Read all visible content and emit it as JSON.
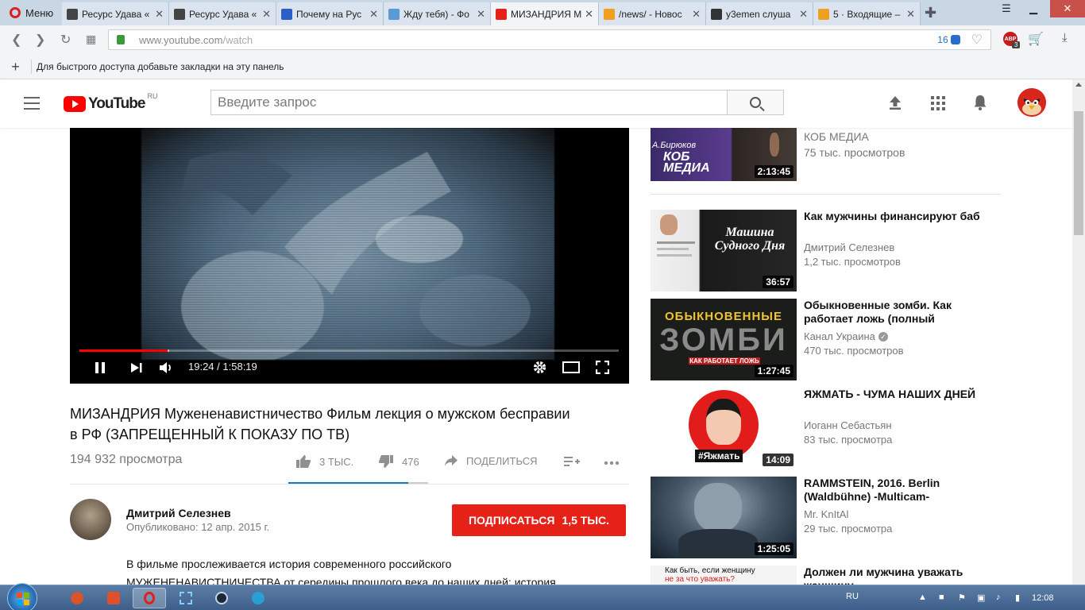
{
  "browser": {
    "menu_label": "Меню",
    "tabs": [
      {
        "title": "Ресурс Удава «",
        "fav_color": "#444444"
      },
      {
        "title": "Ресурс Удава «",
        "fav_color": "#444444"
      },
      {
        "title": "Почему на Рус",
        "fav_color": "#2a5fc7"
      },
      {
        "title": "Жду тебя) - Фо",
        "fav_color": "#5b9bd5"
      },
      {
        "title": "МИЗАНДРИЯ М",
        "fav_color": "#e62117"
      },
      {
        "title": "/news/ - Новос",
        "fav_color": "#f0a020"
      },
      {
        "title": "y3emen слуша",
        "fav_color": "#333333"
      },
      {
        "title": "5 · Входящие –",
        "fav_color": "#f0a020"
      }
    ],
    "url_host": "www.youtube.com",
    "url_path": "/watch",
    "tracker_count": "16",
    "abp_label": "ABP",
    "abp_count": "3",
    "bookmarks_hint": "Для быстрого доступа добавьте закладки на эту панель"
  },
  "youtube": {
    "logo_text": "YouTube",
    "region": "RU",
    "search_placeholder": "Введите запрос"
  },
  "player": {
    "time_current": "19:24",
    "time_total": "1:58:19",
    "progress_played": 0.164,
    "progress_buffered": 0.167
  },
  "video": {
    "title": "МИЗАНДРИЯ Мужененавистничество Фильм лекция о мужском бесправии в РФ (ЗАПРЕЩЕННЫЙ К ПОКАЗУ ПО ТВ)",
    "views": "194 932 просмотра",
    "likes": "3 ТЫС.",
    "dislikes": "476",
    "share_label": "ПОДЕЛИТЬСЯ",
    "like_ratio": 0.86,
    "channel_name": "Дмитрий Селезнев",
    "published": "Опубликовано: 12 апр. 2015 г.",
    "subscribe_label": "ПОДПИСАТЬСЯ",
    "subscriber_count": "1,5 ТЫС.",
    "description_line1": "В фильме прослеживается история современного российского",
    "description_line2": "МУЖЕНЕНАВИСТНИЧЕСТВА от середины прошлого века до наших дней: история,"
  },
  "sidebar": {
    "items": [
      {
        "title": "",
        "channel": "КОБ МЕДИА",
        "views": "75 тыс. просмотров",
        "duration": "2:13:45",
        "thumb_label": "КОБ МЕДИА",
        "thumb_name": "А.Бирюков",
        "verified": false
      },
      {
        "title": "Как мужчины финансируют баб",
        "channel": "Дмитрий Селезнев",
        "views": "1,2 тыс. просмотров",
        "duration": "36:57",
        "thumb_label": "Машина Судного Дня",
        "verified": false
      },
      {
        "title": "Обыкновенные зомби. Как работает ложь (полный",
        "channel": "Канал Украина",
        "views": "470 тыс. просмотров",
        "duration": "1:27:45",
        "thumb_label": "ОБЫКНОВЕННЫЕ",
        "thumb_label2": "ЗОМБИ",
        "thumb_label3": "КАК РАБОТАЕТ ЛОЖЬ",
        "verified": true
      },
      {
        "title": "ЯЖМАТЬ - ЧУМА НАШИХ ДНЕЙ",
        "channel": "Иоганн Себастьян",
        "views": "83 тыс. просмотра",
        "duration": "14:09",
        "thumb_label": "#Яжмать",
        "verified": false
      },
      {
        "title": "RAMMSTEIN, 2016. Berlin (Waldbühne) -Multicam-",
        "channel": "Mr. KnItAl",
        "views": "29 тыс. просмотра",
        "duration": "1:25:05",
        "verified": false
      },
      {
        "title": "Должен ли мужчина уважать женщину",
        "channel": "",
        "views": "",
        "duration": "",
        "thumb_label": "Как быть, если женщину",
        "thumb_label2": "не за что уважать?",
        "verified": false
      }
    ]
  },
  "taskbar": {
    "lang": "RU",
    "time": "12:08"
  }
}
